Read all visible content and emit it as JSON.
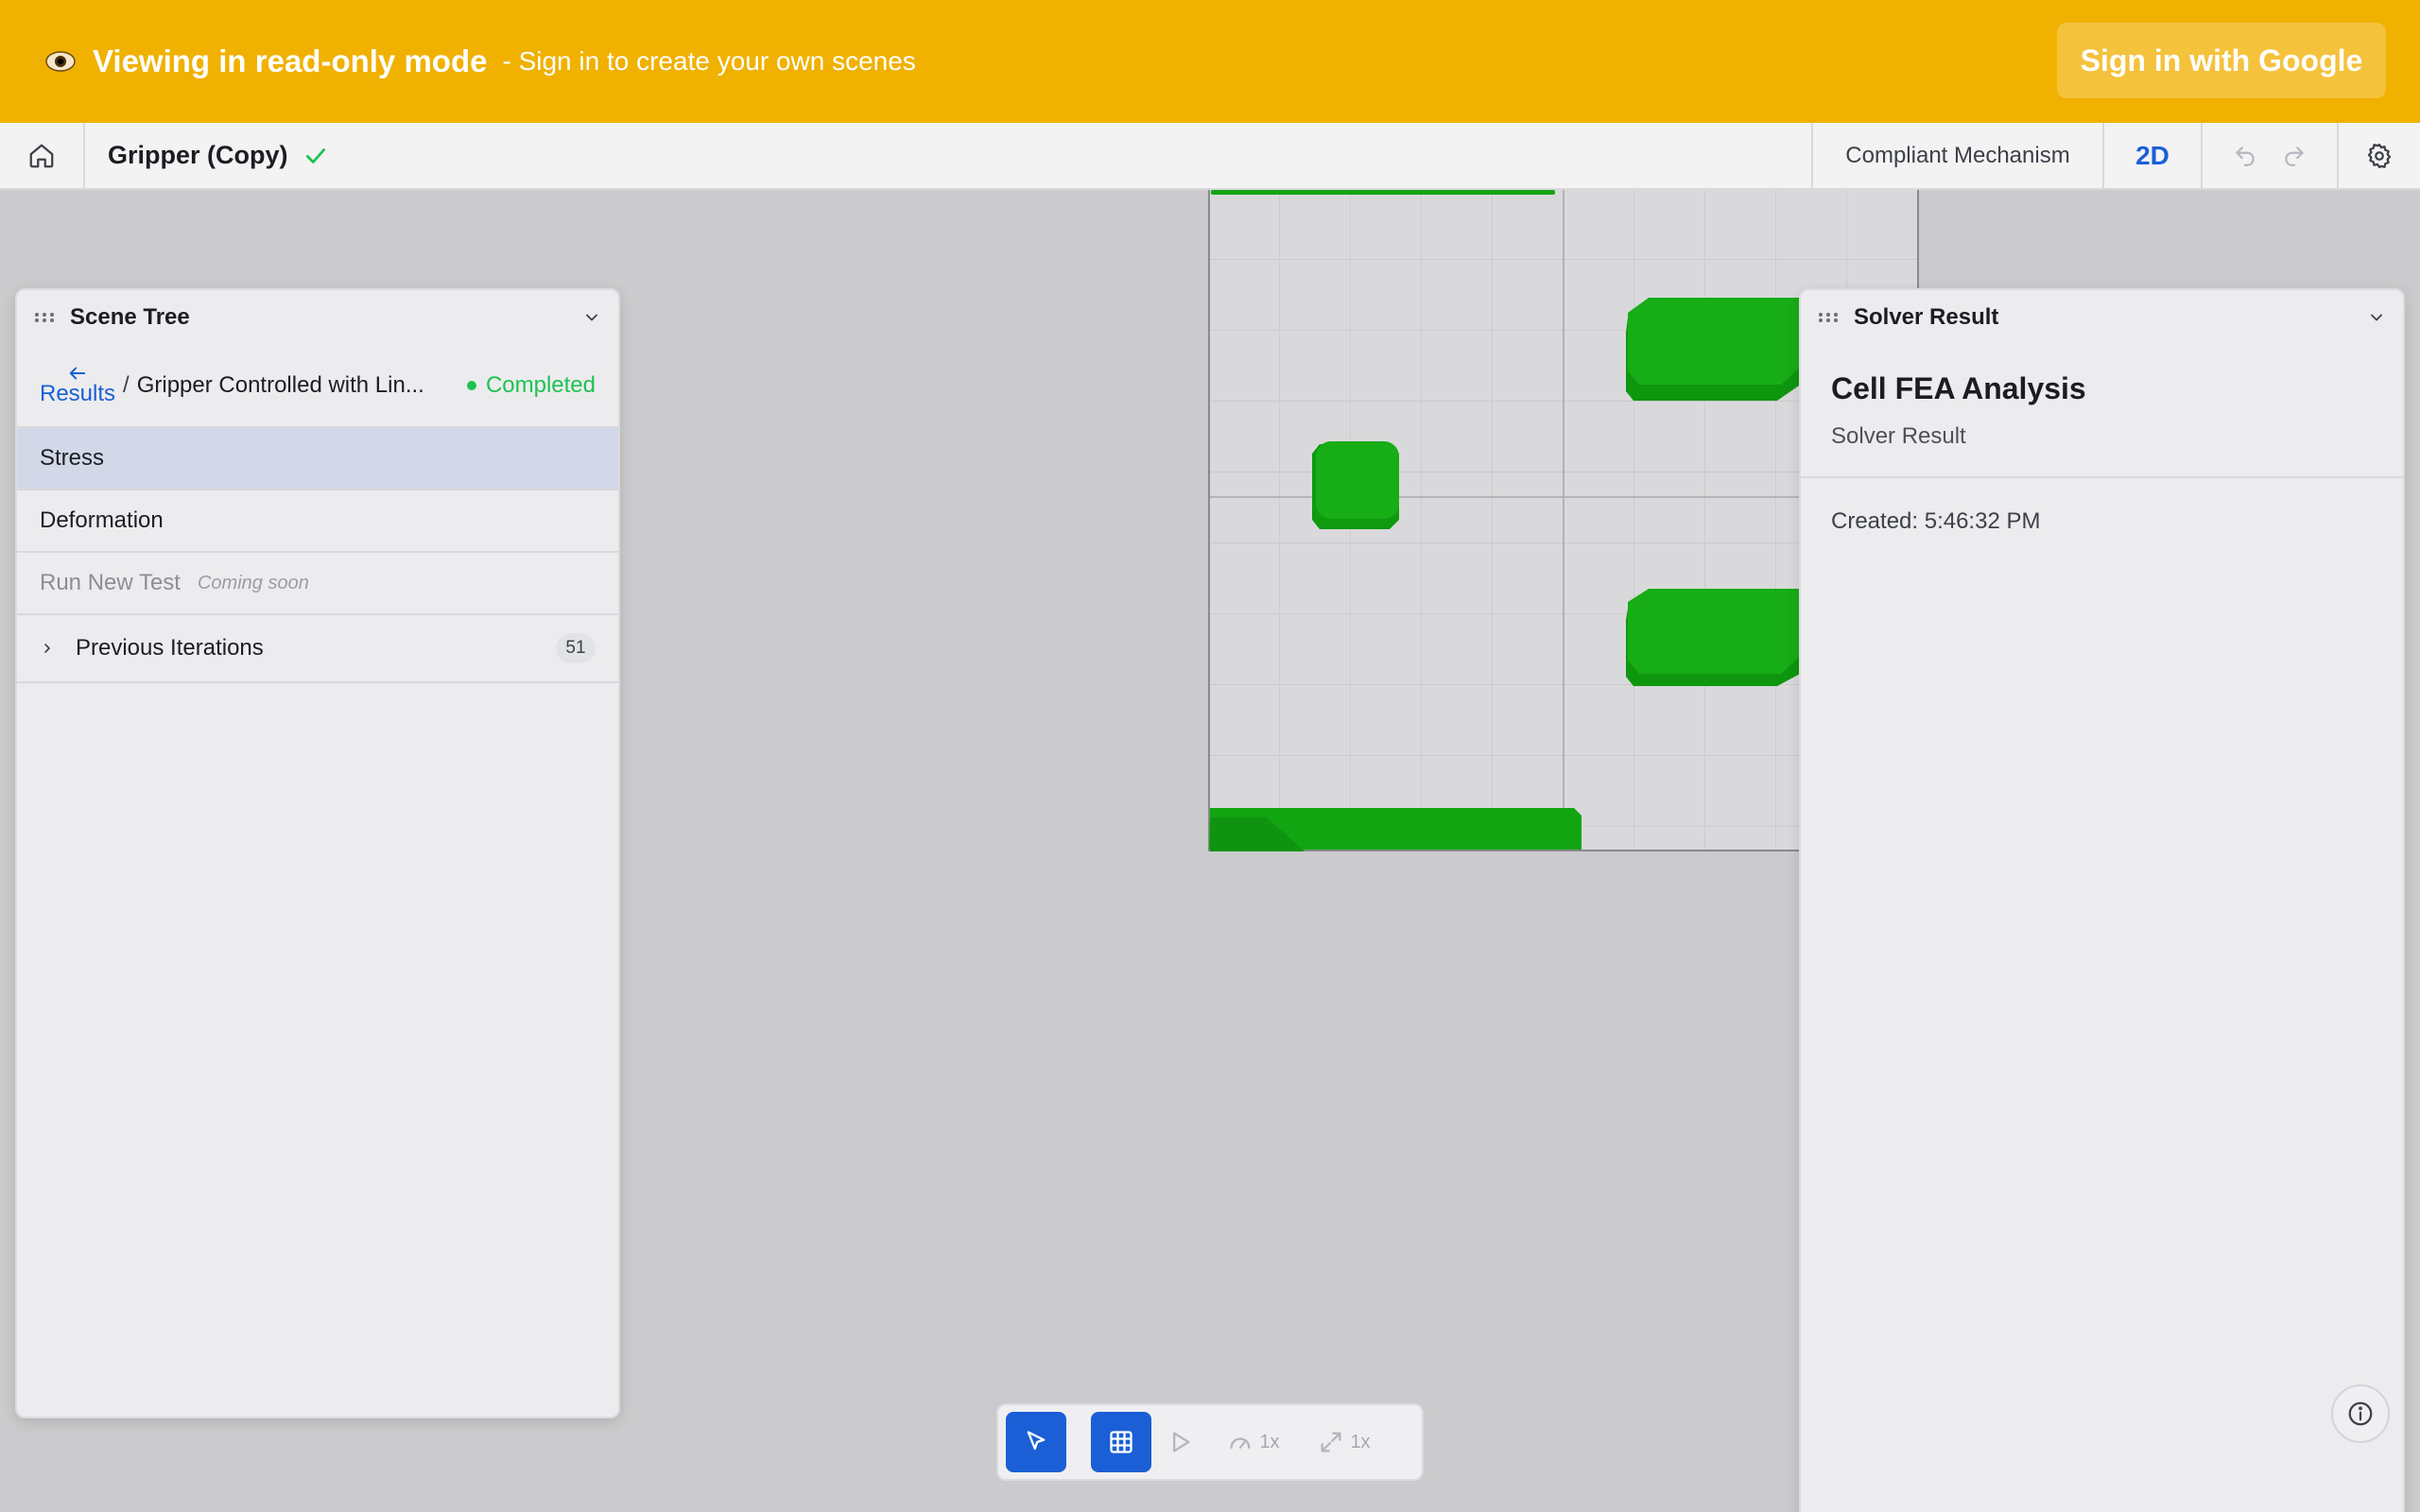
{
  "banner": {
    "title": "Viewing in read-only mode",
    "subtitle": "- Sign in to create your own scenes",
    "signin_label": "Sign in with Google"
  },
  "toolbar": {
    "scene_title": "Gripper (Copy)",
    "mode_label": "Compliant Mechanism",
    "dimension_label": "2D"
  },
  "scene_tree": {
    "title": "Scene Tree",
    "back_label": "Results",
    "breadcrumb_separator": "/",
    "breadcrumb_path": "Gripper Controlled with Lin...",
    "status": "Completed",
    "items": {
      "stress": "Stress",
      "deformation": "Deformation",
      "run_new_test": "Run New Test",
      "coming_soon": "Coming soon",
      "previous_iterations": "Previous Iterations",
      "iterations_count": "51"
    }
  },
  "solver_result": {
    "title": "Solver Result",
    "result_title": "Cell FEA Analysis",
    "result_subtitle": "Solver Result",
    "created": "Created: 5:46:32 PM"
  },
  "controls": {
    "speed_label": "1x",
    "scale_label": "1x"
  },
  "colors": {
    "banner": "#f0b100",
    "accent": "#1a5fd6",
    "success": "#1fc251",
    "mesh_green": "#12a512"
  },
  "icons": [
    "eye-icon",
    "home-icon",
    "check-icon",
    "undo-icon",
    "redo-icon",
    "gear-icon",
    "grip-icon",
    "chevron-down-icon",
    "arrow-left-icon",
    "chevron-right-icon",
    "info-icon",
    "cursor-icon",
    "grid-icon",
    "play-icon",
    "speed-icon",
    "expand-icon"
  ]
}
